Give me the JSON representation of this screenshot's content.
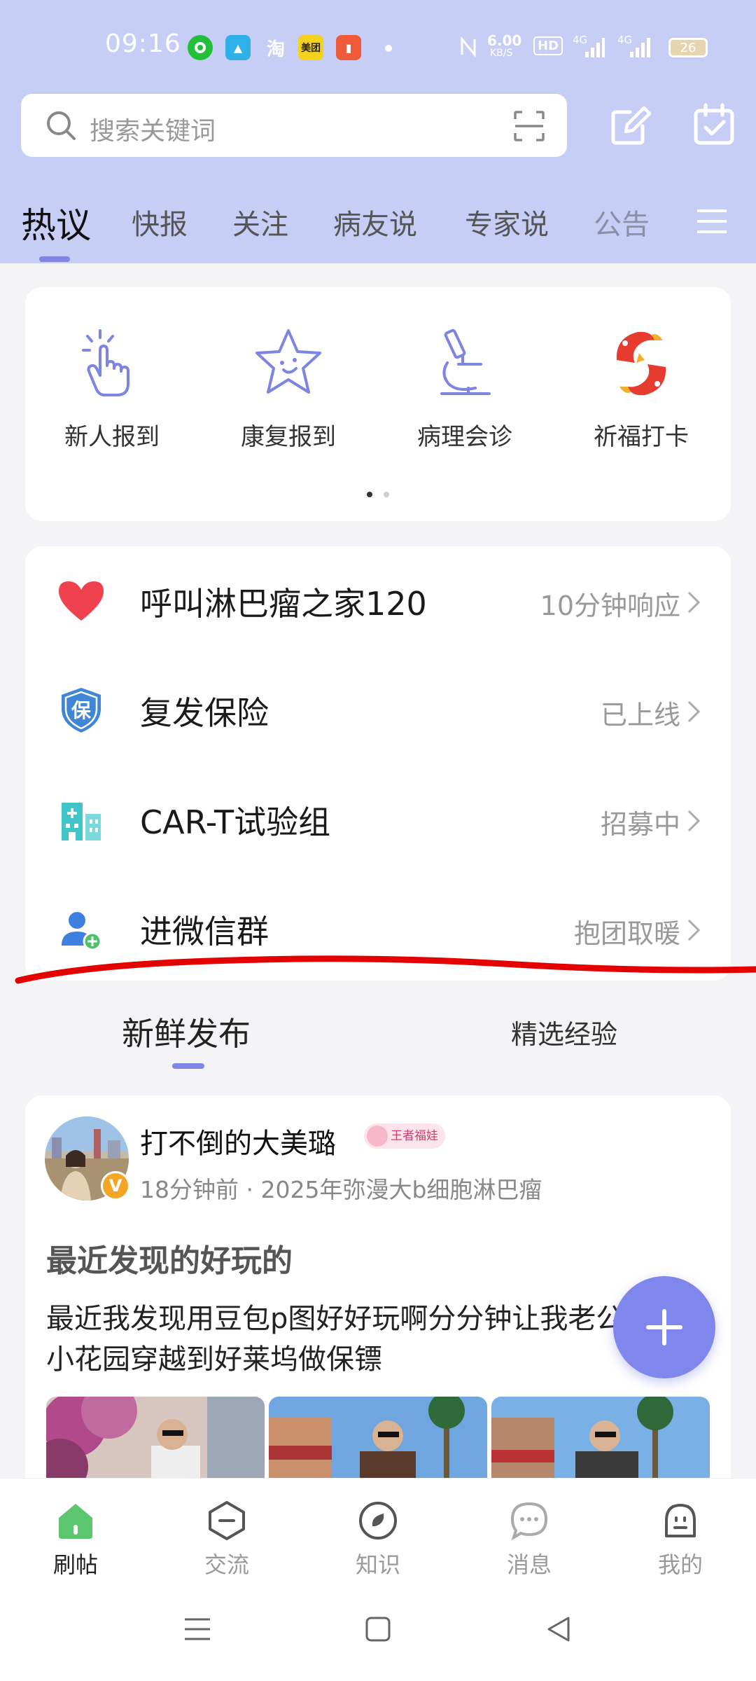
{
  "status_bar": {
    "time": "09:16",
    "apps": [
      "green-circle-app",
      "camel-app",
      "taobao-app",
      "meituan-app",
      "book-app"
    ],
    "taobao_label": "淘",
    "meituan_label": "美团",
    "speed_value": "6.00",
    "speed_unit": "KB/S",
    "hd_label": "HD",
    "signal_1": "4G",
    "signal_2": "4G",
    "battery": "26"
  },
  "search": {
    "placeholder": "搜索关键词"
  },
  "tabs": [
    "热议",
    "快报",
    "关注",
    "病友说",
    "专家说",
    "公告"
  ],
  "quick_actions": [
    {
      "label": "新人报到",
      "icon": "tap-hand-icon"
    },
    {
      "label": "康复报到",
      "icon": "star-face-icon"
    },
    {
      "label": "病理会诊",
      "icon": "microscope-icon"
    },
    {
      "label": "祈福打卡",
      "icon": "koi-fish-icon"
    }
  ],
  "services": [
    {
      "title": "呼叫淋巴瘤之家120",
      "status": "10分钟响应",
      "icon": "heart-icon"
    },
    {
      "title": "复发保险",
      "status": "已上线",
      "icon": "shield-icon",
      "icon_text": "保"
    },
    {
      "title": "CAR-T试验组",
      "status": "招募中",
      "icon": "building-icon"
    },
    {
      "title": "进微信群",
      "status": "抱团取暖",
      "icon": "add-user-icon"
    }
  ],
  "feed_tabs": {
    "active": "新鲜发布",
    "other": "精选经验"
  },
  "post": {
    "author": "打不倒的大美璐",
    "verified": "V",
    "rank_badge": "王者福娃",
    "meta": "18分钟前 · 2025年弥漫大b细胞淋巴瘤",
    "title": "最近发现的好玩的",
    "body": "最近我发现用豆包p图好好玩啊分分钟让我老公从楼下小花园穿越到好莱坞做保镖"
  },
  "bottom_nav": [
    "刷帖",
    "交流",
    "知识",
    "消息",
    "我的"
  ],
  "colors": {
    "accent": "#7f86e6",
    "header_bg": "#c6cef6",
    "active_green": "#5cc66f",
    "annotation_red": "#e50000"
  }
}
